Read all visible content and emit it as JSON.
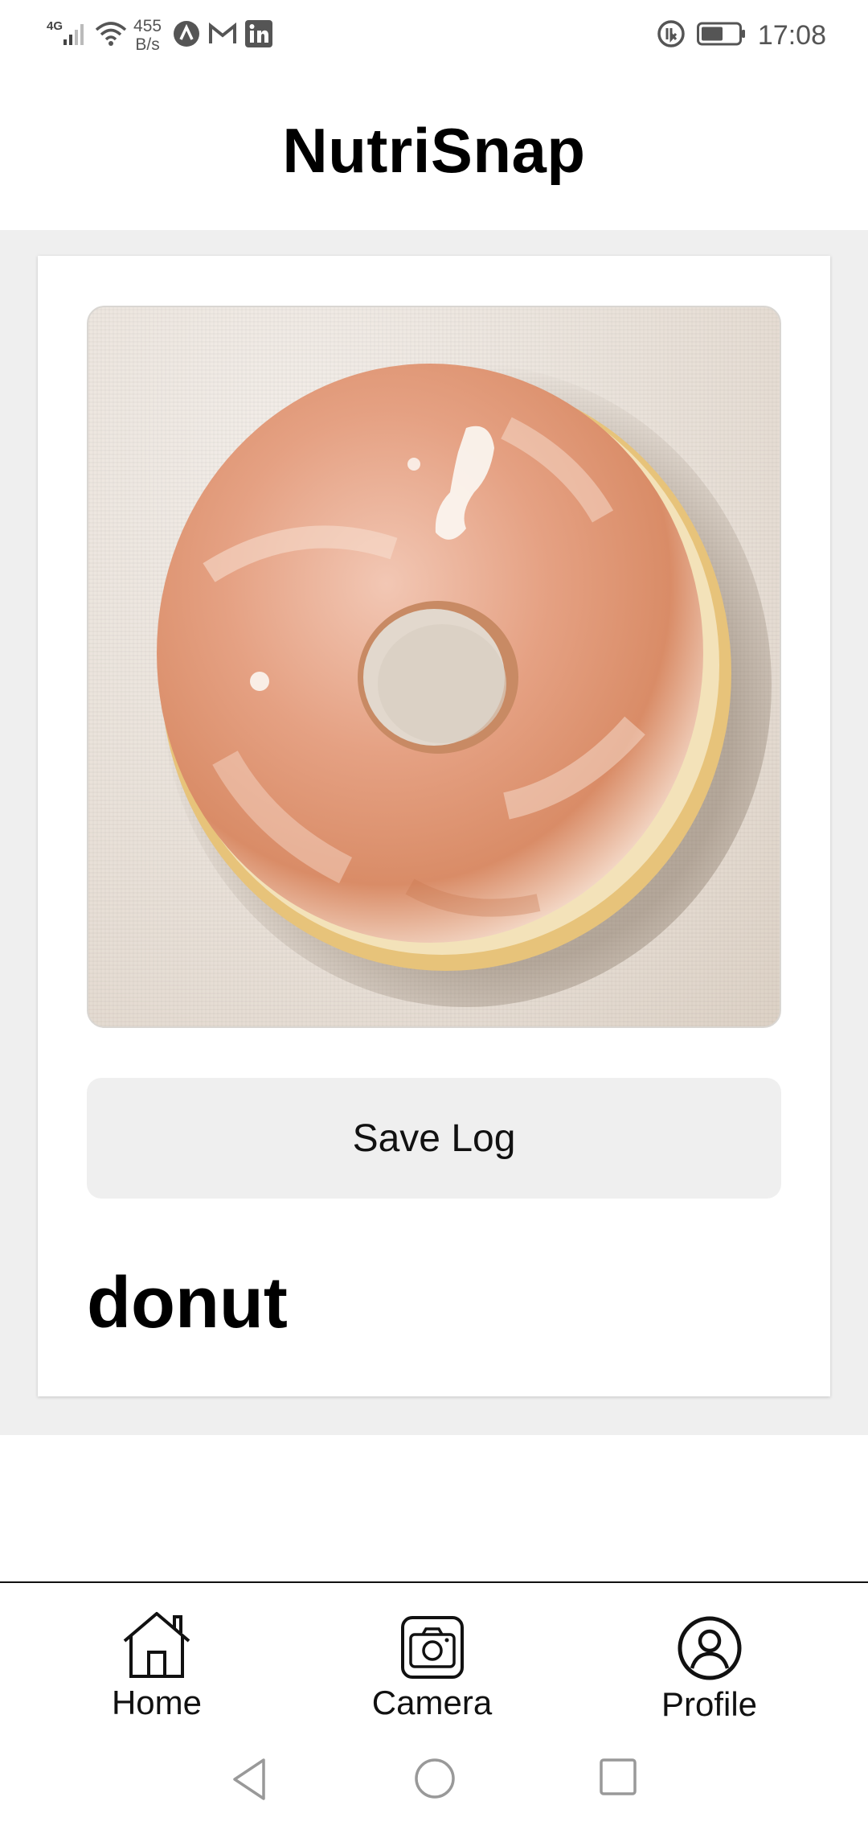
{
  "status_bar": {
    "network": "4G",
    "speed_value": "455",
    "speed_unit": "B/s",
    "time": "17:08",
    "icons": [
      "signal-icon",
      "wifi-icon",
      "app-notification-icon",
      "gmail-icon",
      "linkedin-icon",
      "data-saver-icon",
      "battery-icon"
    ]
  },
  "header": {
    "title": "NutriSnap"
  },
  "card": {
    "image_subject": "donut-photo",
    "save_button_label": "Save Log",
    "food_name": "donut"
  },
  "bottom_nav": {
    "items": [
      {
        "label": "Home",
        "icon": "home-icon"
      },
      {
        "label": "Camera",
        "icon": "camera-icon"
      },
      {
        "label": "Profile",
        "icon": "profile-icon"
      }
    ]
  },
  "system_nav": {
    "icons": [
      "back-icon",
      "home-circle-icon",
      "recents-icon"
    ]
  }
}
